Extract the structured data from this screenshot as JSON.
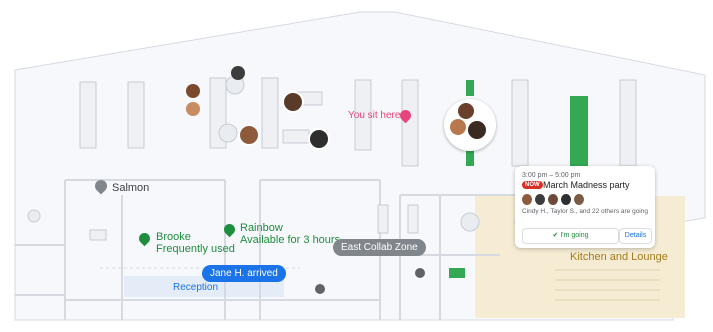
{
  "map": {
    "you_sit_here": "You sit here",
    "salmon": "Salmon",
    "east_collab_zone": "East Collab Zone",
    "reception": "Reception",
    "kitchen_and_lounge": "Kitchen and Lounge",
    "rooms": [
      {
        "name": "Brooke",
        "status": "Frequently used"
      },
      {
        "name": "Rainbow",
        "status": "Available for 3 hours"
      }
    ],
    "arrival_chip": "Jane H. arrived"
  },
  "event_card": {
    "time": "3:00 pm – 5:00 pm",
    "now_badge": "NOW",
    "title": "March Madness party",
    "attendees": "Cindy H., Taylor S., and 22  others are going",
    "going_label": "I'm going",
    "details_label": "Details"
  },
  "colors": {
    "pin_green": "#1e8e3e",
    "pin_pink": "#e8437a",
    "chip_blue": "#1a73e8",
    "zone_gray": "#80868b",
    "desk_green": "#34a853",
    "kitchen": "#f5ecd3",
    "reception": "#e3ecf7"
  }
}
